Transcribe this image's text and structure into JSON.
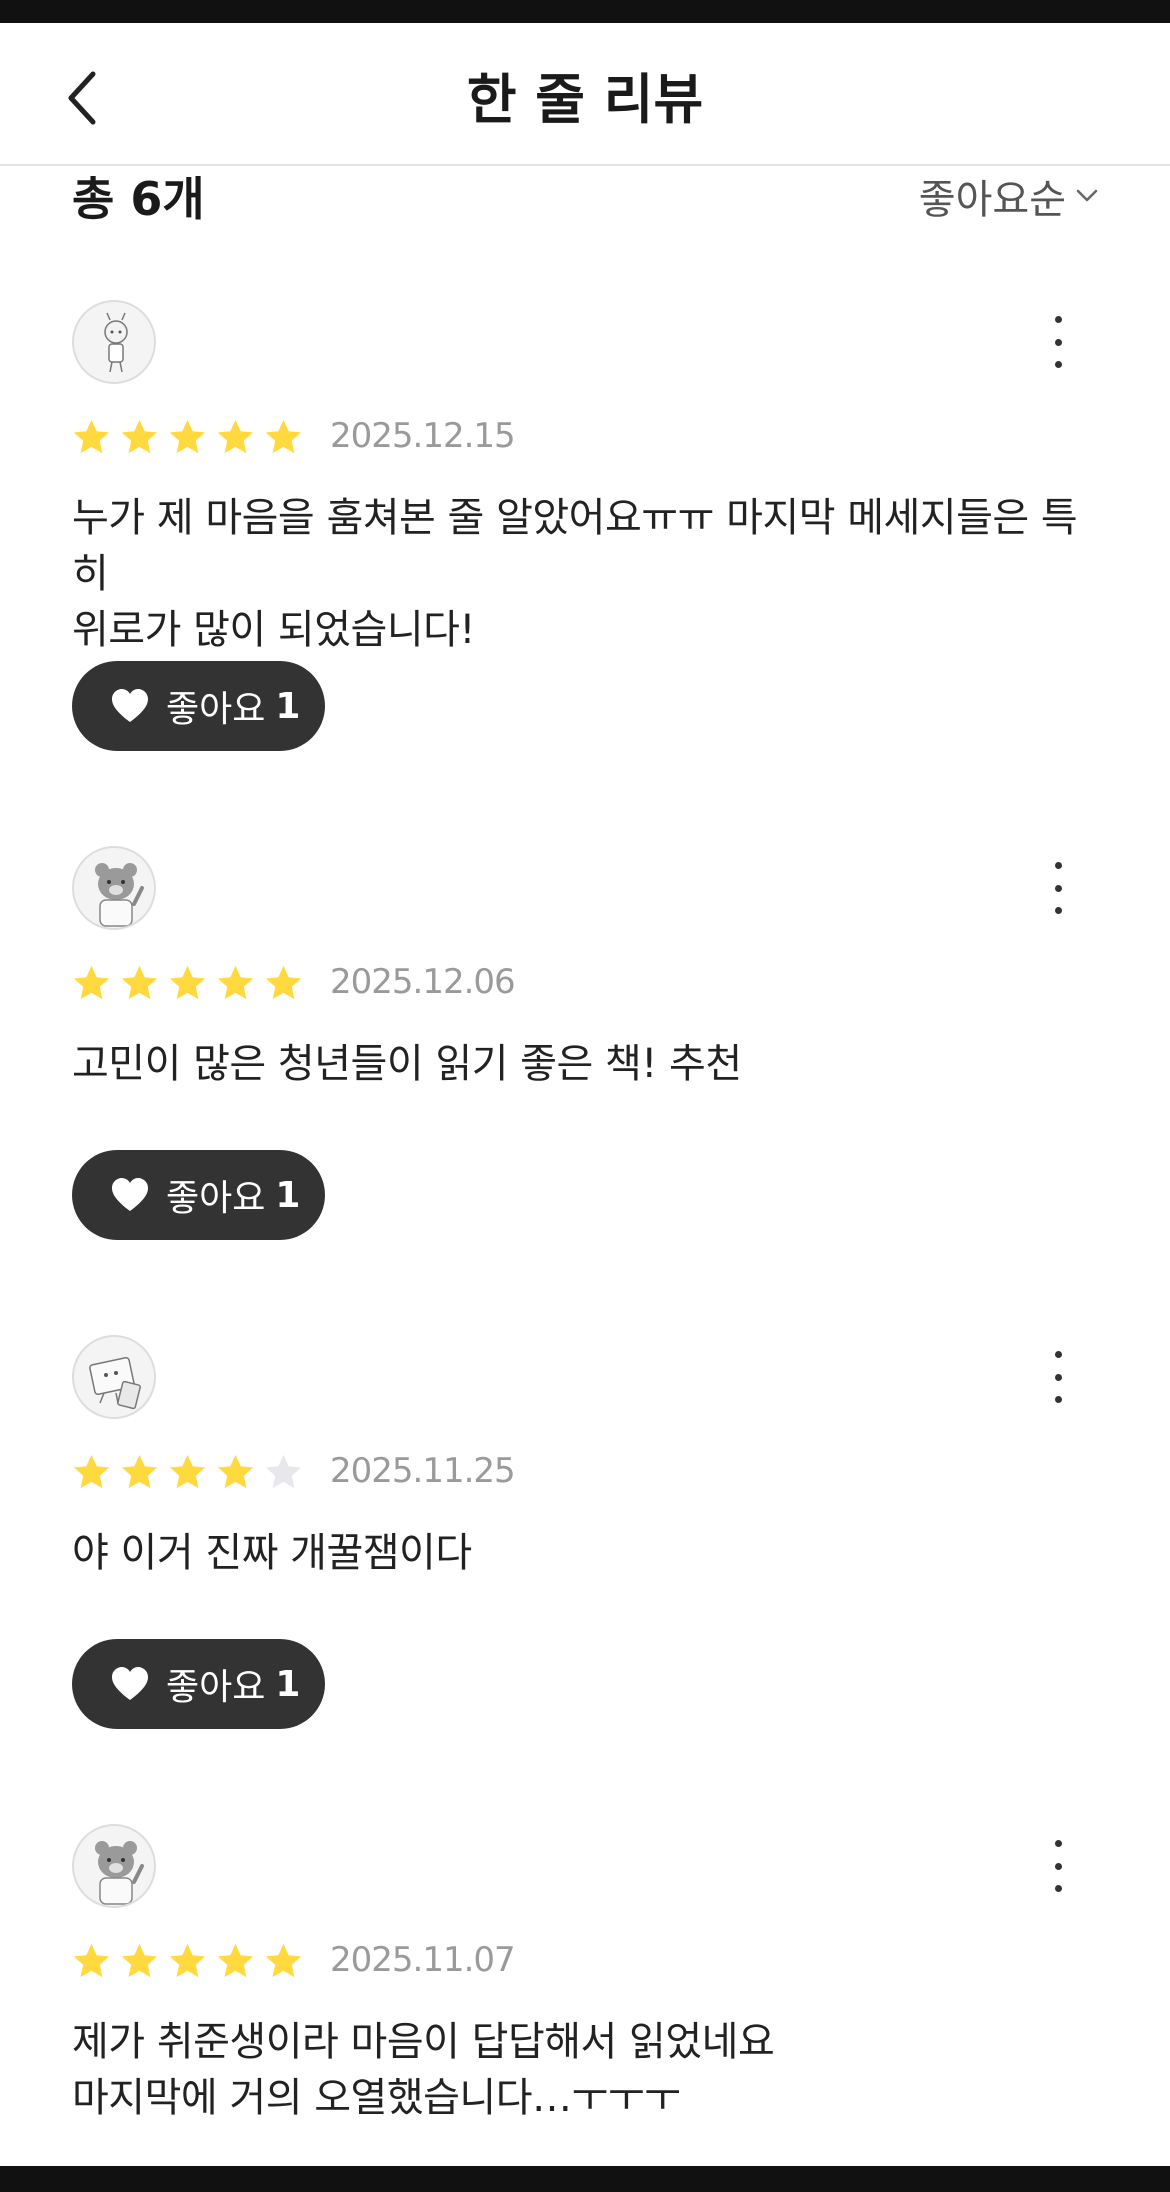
{
  "header": {
    "title": "한 줄 리뷰",
    "back_icon": "chevron-left-icon"
  },
  "summary": {
    "count_label": "총 6개",
    "sort_label": "좋아요순",
    "sort_icon": "chevron-down-icon"
  },
  "colors": {
    "star_filled": "#FFD93D",
    "star_empty": "#E8E8EC",
    "like_button_bg": "#333333",
    "date_text": "#9A9A9A"
  },
  "reviews": [
    {
      "avatar": "character-avatar",
      "rating": 5,
      "date": "2025.12.15",
      "text": "누가 제 마음을 훔쳐본 줄 알았어요ㅠㅠ 마지막 메세지들은 특히\n위로가 많이 되었습니다!",
      "like_label": "좋아요",
      "like_count": "1"
    },
    {
      "avatar": "bear-avatar",
      "rating": 5,
      "date": "2025.12.06",
      "text": "고민이 많은 청년들이 읽기 좋은 책! 추천",
      "like_label": "좋아요",
      "like_count": "1"
    },
    {
      "avatar": "laptop-avatar",
      "rating": 4,
      "date": "2025.11.25",
      "text": "야 이거 진짜 개꿀잼이다",
      "like_label": "좋아요",
      "like_count": "1"
    },
    {
      "avatar": "bear-avatar",
      "rating": 5,
      "date": "2025.11.07",
      "text": "제가 취준생이라 마음이 답답해서 읽었네요\n마지막에 거의 오열했습니다…ㅜㅜㅜ"
    }
  ]
}
